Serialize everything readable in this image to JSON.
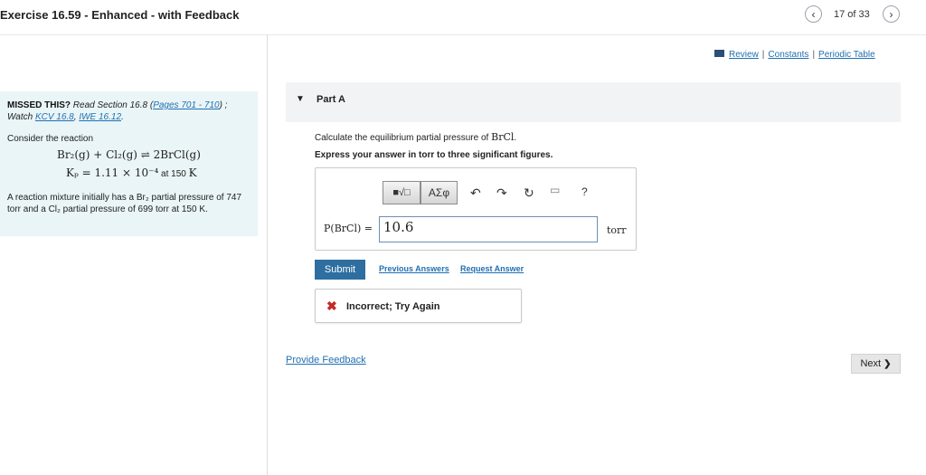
{
  "header": {
    "title": "Exercise 16.59 - Enhanced - with Feedback",
    "position": "17 of 33",
    "prev_glyph": "‹",
    "next_glyph": "›"
  },
  "left_panel": {
    "missed_title": "MISSED THIS?",
    "missed_read": " Read Section 16.8 (",
    "missed_pages": "Pages 701 - 710",
    "missed_close": ") ;",
    "watch": "Watch ",
    "kcv": "KCV 16.8",
    "comma": ", ",
    "iwe": "IWE 16.12",
    "period": ".",
    "consider": "Consider the reaction",
    "equation": "Br₂(g) + Cl₂(g) ⇌ 2BrCl(g)",
    "kp_expr": "Kₚ = 1.11 × 10⁻⁴",
    "kp_at": " at 150 ",
    "kp_unit": "K",
    "mixture_text": "A reaction mixture initially has a Br₂ partial pressure of 747 torr and a Cl₂ partial pressure of 699 torr at 150 K."
  },
  "top_links": {
    "review": "Review",
    "constants": "Constants",
    "periodic": "Periodic Table",
    "separator": "|"
  },
  "part": {
    "label": "Part A",
    "caret": "▼"
  },
  "question": {
    "calc_text": "Calculate the equilibrium partial pressure of ",
    "calc_species": "BrCl",
    "calc_end": ".",
    "express": "Express your answer in torr to three significant figures."
  },
  "toolbar": {
    "template_label": "■√□",
    "greek_label": "ΑΣφ",
    "undo_icon": "↶",
    "redo_icon": "↷",
    "reset_icon": "↻",
    "keyboard_label": "▭",
    "help_label": "?"
  },
  "answer": {
    "label": "P(BrCl) =",
    "value": "10.6",
    "unit": "torr"
  },
  "actions": {
    "submit": "Submit",
    "previous_answers": "Previous Answers",
    "request_answer": "Request Answer"
  },
  "feedback": {
    "icon": "✖",
    "text": "Incorrect; Try Again"
  },
  "footer": {
    "provide_feedback": "Provide Feedback",
    "next": "Next",
    "next_glyph": "❯"
  },
  "colors": {
    "link": "#1f6fb2",
    "submit_bg": "#2e6ea0",
    "left_panel_bg": "#e9f5f7",
    "error": "#c62828"
  }
}
